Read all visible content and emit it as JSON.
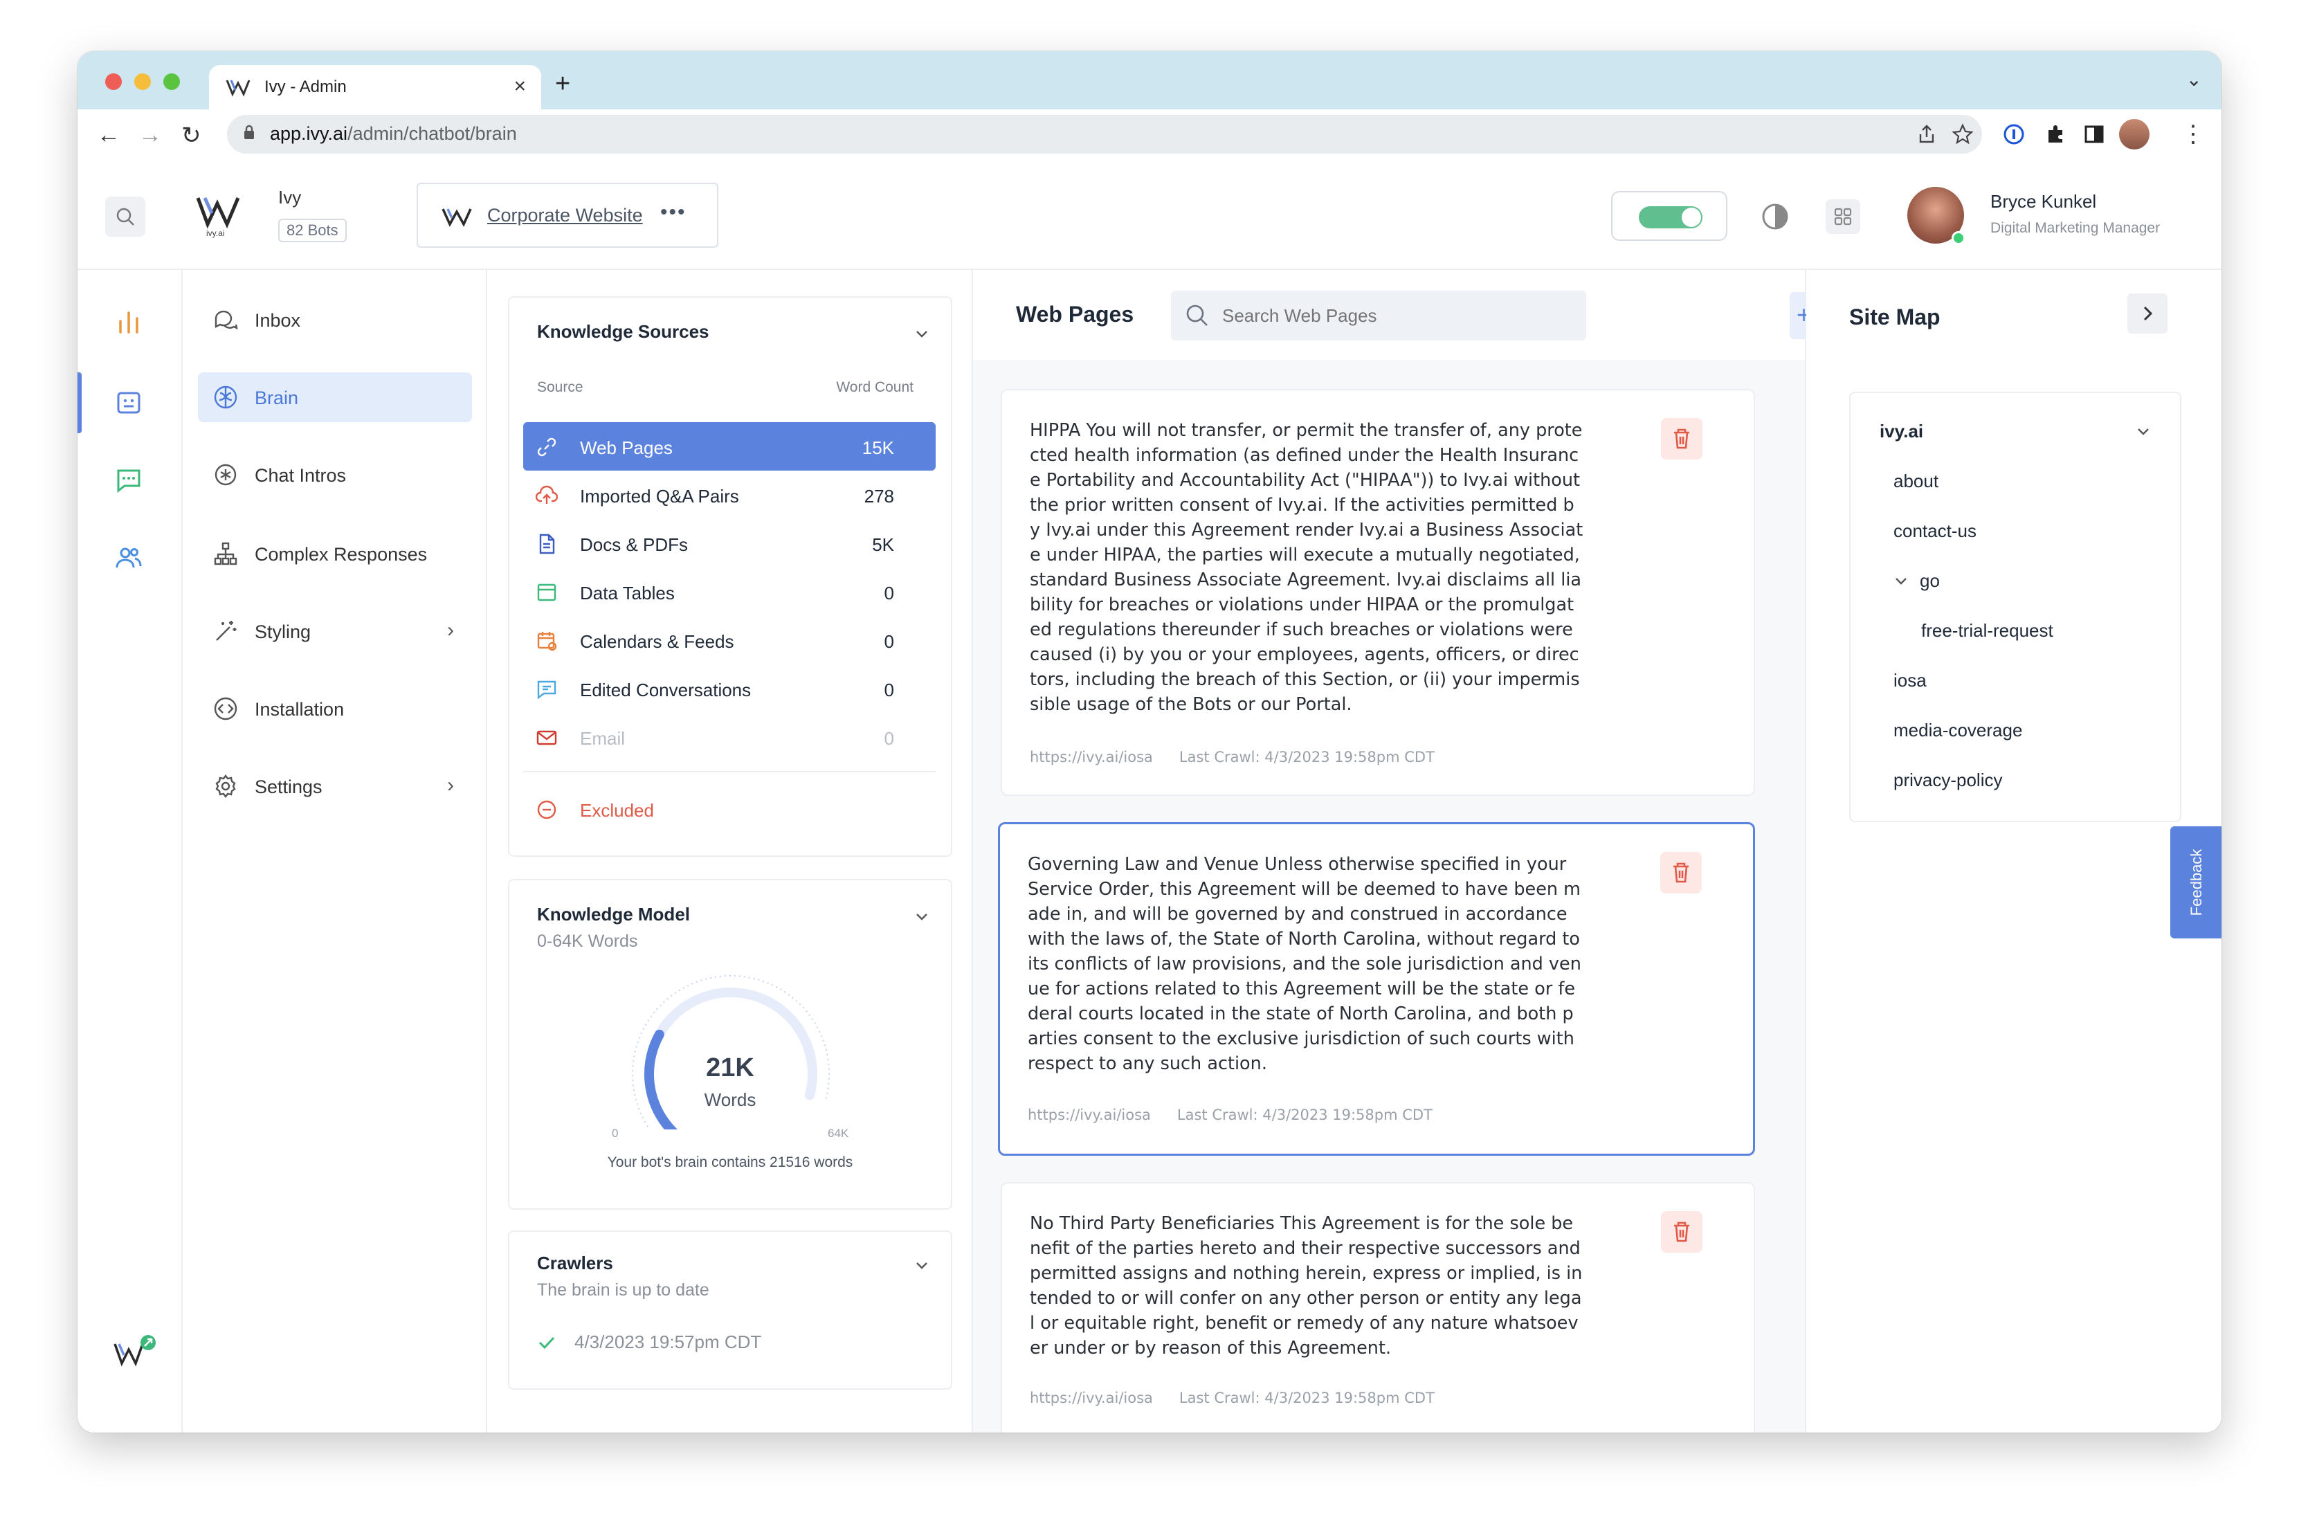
{
  "browser": {
    "tab_title": "Ivy - Admin",
    "tab_close": "×",
    "new_tab": "+",
    "url_host": "app.ivy.ai",
    "url_path": "/admin/chatbot/brain"
  },
  "header": {
    "bot_name": "Ivy",
    "bot_count": "82 Bots",
    "logo_sub": "ivy.ai",
    "bot_selector": "Corporate Website",
    "bot_more": "•••",
    "toggle_on": true,
    "user_name": "Bryce Kunkel",
    "user_role": "Digital Marketing Manager"
  },
  "side_nav": {
    "items": [
      {
        "label": "Inbox",
        "icon": "inbox-icon"
      },
      {
        "label": "Brain",
        "icon": "brain-icon",
        "active": true
      },
      {
        "label": "Chat Intros",
        "icon": "chat-intro-icon"
      },
      {
        "label": "Complex Responses",
        "icon": "flow-icon"
      },
      {
        "label": "Styling",
        "icon": "magic-wand-icon",
        "chevron": "›"
      },
      {
        "label": "Installation",
        "icon": "code-icon"
      },
      {
        "label": "Settings",
        "icon": "gear-icon",
        "chevron": "›"
      }
    ]
  },
  "knowledge_sources": {
    "title": "Knowledge Sources",
    "col_source": "Source",
    "col_count": "Word Count",
    "rows": [
      {
        "label": "Web Pages",
        "value": "15K",
        "icon": "link-icon",
        "active": true
      },
      {
        "label": "Imported Q&A Pairs",
        "value": "278",
        "icon": "upload-icon"
      },
      {
        "label": "Docs & PDFs",
        "value": "5K",
        "icon": "document-icon"
      },
      {
        "label": "Data Tables",
        "value": "0",
        "icon": "table-icon"
      },
      {
        "label": "Calendars & Feeds",
        "value": "0",
        "icon": "calendar-icon"
      },
      {
        "label": "Edited Conversations",
        "value": "0",
        "icon": "conversation-icon"
      },
      {
        "label": "Email",
        "value": "0",
        "icon": "email-icon",
        "disabled": true
      }
    ],
    "excluded": "Excluded"
  },
  "knowledge_model": {
    "title": "Knowledge Model",
    "subtitle": "0-64K Words",
    "gauge_value": "21K",
    "gauge_unit": "Words",
    "gauge_min": "0",
    "gauge_max": "64K",
    "gauge_fraction": 0.336,
    "caption": "Your bot's brain contains 21516 words"
  },
  "crawlers": {
    "title": "Crawlers",
    "status": "The brain is up to date",
    "last": "4/3/2023 19:57pm CDT"
  },
  "web_pages": {
    "title": "Web Pages",
    "search_placeholder": "Search Web Pages",
    "add": "+",
    "items": [
      {
        "text": "HIPPA You will not transfer, or permit the transfer of, any protected health information (as defined under the Health Insurance Portability and Accountability Act (\"HIPAA\")) to Ivy.ai without the prior written consent of Ivy.ai. If the activities permitted by Ivy.ai under this Agreement render Ivy.ai a Business Associate under HIPAA, the parties will execute a mutually negotiated, standard Business Associate Agreement. Ivy.ai disclaims all liability for breaches or violations under HIPAA or the promulgated regulations thereunder if such breaches or violations were caused (i) by you or your employees, agents, officers, or directors, including the breach of this Section, or (ii) your impermissible usage of the Bots or our Portal.",
        "url": "https://ivy.ai/iosa",
        "crawl": "Last Crawl: 4/3/2023 19:58pm CDT"
      },
      {
        "text": "Governing Law and Venue Unless otherwise specified in your Service Order, this Agreement will be deemed to have been made in, and will be governed by and construed in accordance with the laws of, the State of North Carolina, without regard to its conflicts of law provisions, and the sole jurisdiction and venue for actions related to this Agreement will be the state or federal courts located in the state of North Carolina, and both parties consent to the exclusive jurisdiction of such courts with respect to any such action.",
        "url": "https://ivy.ai/iosa",
        "crawl": "Last Crawl: 4/3/2023 19:58pm CDT"
      },
      {
        "text": "No Third Party Beneficiaries This Agreement is for the sole benefit of the parties hereto and their respective successors and permitted assigns and nothing herein, express or implied, is intended to or will confer on any other person or entity any legal or equitable right, benefit or remedy of any nature whatsoever under or by reason of this Agreement.",
        "url": "https://ivy.ai/iosa",
        "crawl": "Last Crawl: 4/3/2023 19:58pm CDT"
      }
    ]
  },
  "site_map": {
    "title": "Site Map",
    "root": "ivy.ai",
    "items": [
      "about",
      "contact-us",
      "go",
      "free-trial-request",
      "iosa",
      "media-coverage",
      "privacy-policy"
    ]
  },
  "feedback_tab": "Feedback",
  "colors": {
    "accent": "#5b82dd",
    "active_bg": "#e3ecfb",
    "toggle": "#5fbf8e",
    "danger": "#e05a47"
  }
}
